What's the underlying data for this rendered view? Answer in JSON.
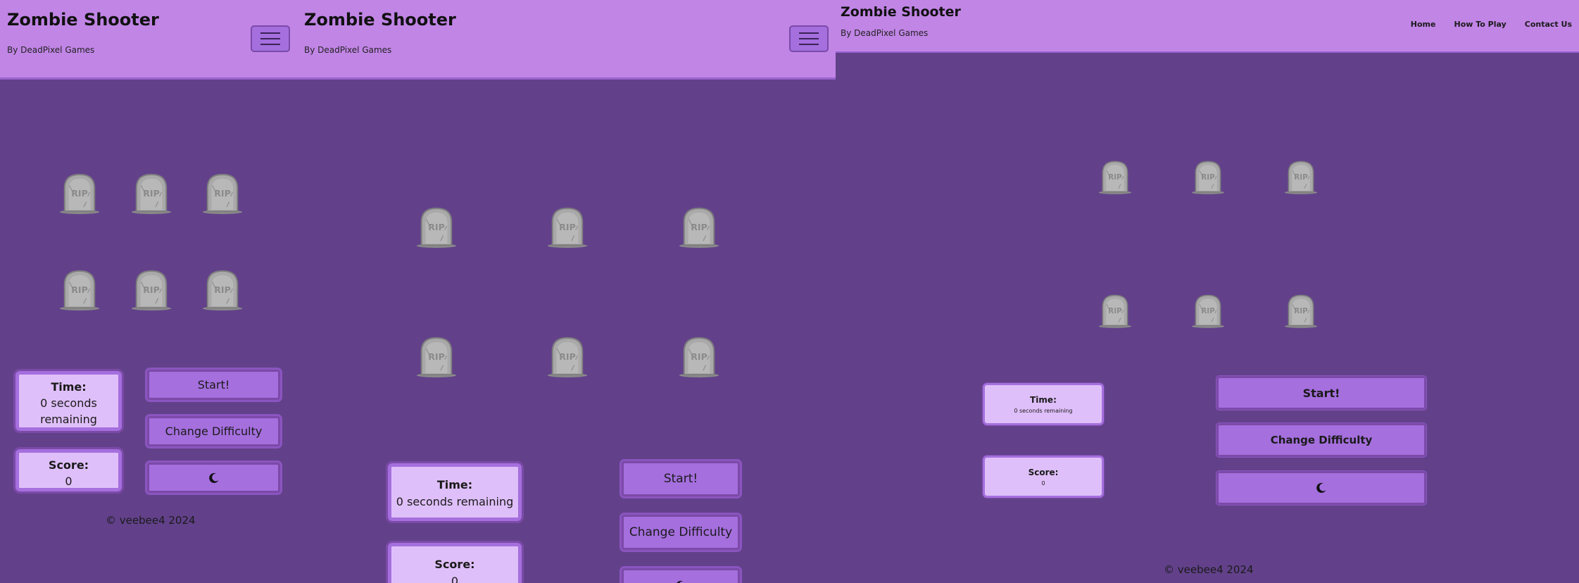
{
  "site": {
    "title": "Zombie Shooter",
    "byline": "By DeadPixel Games"
  },
  "nav": {
    "home": "Home",
    "how_to_play": "How To Play",
    "contact_us": "Contact Us"
  },
  "icons": {
    "menu": "hamburger-menu-icon",
    "tombstone": "tombstone-icon",
    "theme": "moon-icon"
  },
  "game": {
    "time_label": "Time:",
    "time_value": "0 seconds remaining",
    "score_label": "Score:",
    "score_value": "0",
    "start_label": "Start!",
    "difficulty_label": "Change Difficulty"
  },
  "footer": {
    "copyright": "© veebee4 2024"
  },
  "colors": {
    "background": "#62418a",
    "header": "#c185e6",
    "button": "#a56fde",
    "button_border": "#7b4aa8",
    "stat_box": "#dfbff9"
  }
}
